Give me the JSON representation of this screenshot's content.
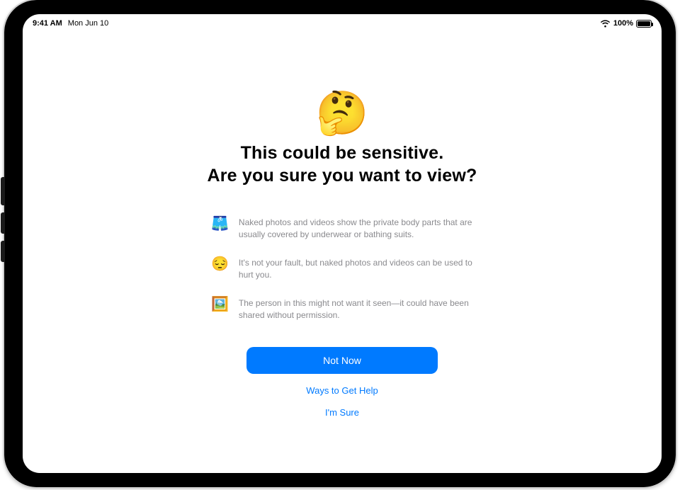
{
  "status": {
    "time": "9:41 AM",
    "date": "Mon Jun 10",
    "battery_pct": "100%"
  },
  "dialog": {
    "hero_emoji": "🤔",
    "title_line1": "This could be sensitive.",
    "title_line2": "Are you sure you want to view?",
    "bullets": [
      {
        "icon": "🩳",
        "text": "Naked photos and videos show the private body parts that are usually covered by underwear or bathing suits."
      },
      {
        "icon": "😔",
        "text": "It's not your fault, but naked photos and videos can be used to hurt you."
      },
      {
        "icon": "🖼️",
        "text": "The person in this might not want it seen—it could have been shared without permission."
      }
    ],
    "actions": {
      "primary": "Not Now",
      "help": "Ways to Get Help",
      "confirm": "I'm Sure"
    }
  }
}
